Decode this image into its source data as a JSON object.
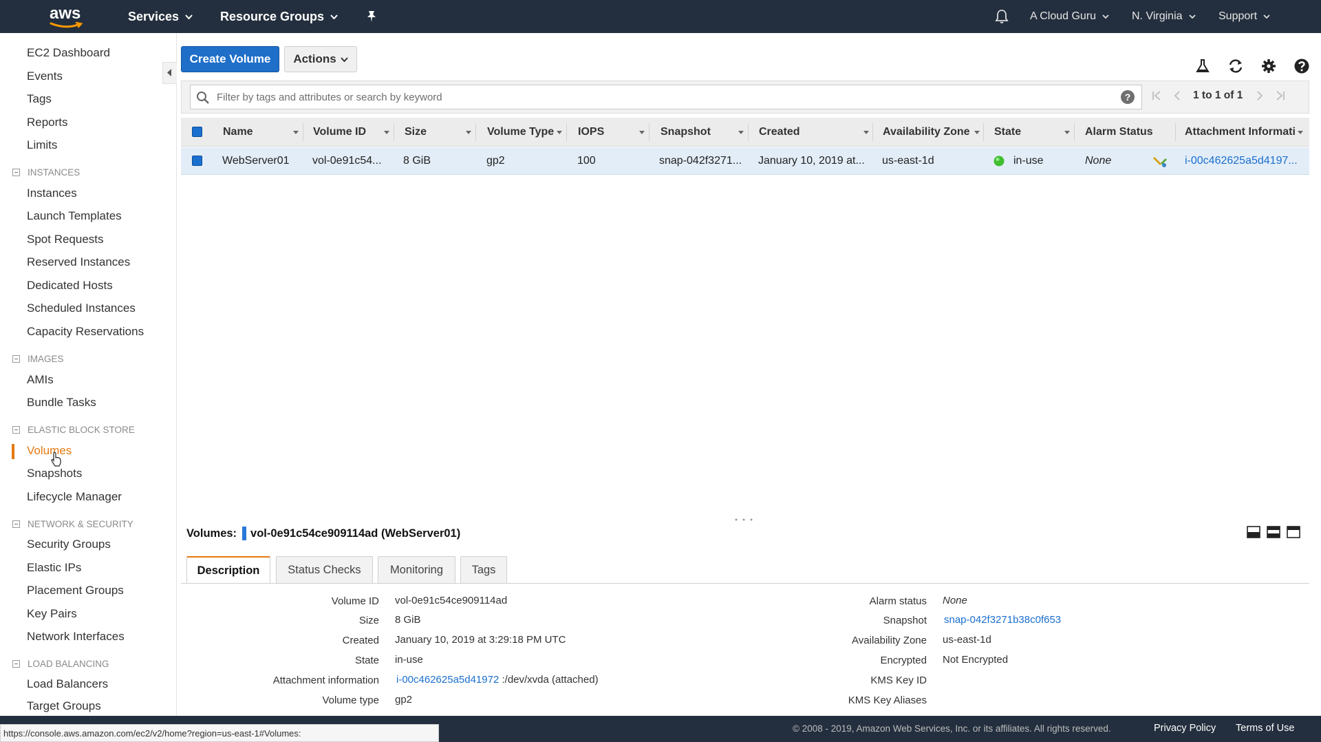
{
  "topnav": {
    "logo": "aws",
    "services": "Services",
    "resource_groups": "Resource Groups",
    "account": "A Cloud Guru",
    "region": "N. Virginia",
    "support": "Support"
  },
  "sidebar": {
    "top_items": [
      "EC2 Dashboard",
      "Events",
      "Tags",
      "Reports",
      "Limits"
    ],
    "sections": [
      {
        "title": "INSTANCES",
        "items": [
          "Instances",
          "Launch Templates",
          "Spot Requests",
          "Reserved Instances",
          "Dedicated Hosts",
          "Scheduled Instances",
          "Capacity Reservations"
        ]
      },
      {
        "title": "IMAGES",
        "items": [
          "AMIs",
          "Bundle Tasks"
        ]
      },
      {
        "title": "ELASTIC BLOCK STORE",
        "items": [
          "Volumes",
          "Snapshots",
          "Lifecycle Manager"
        ]
      },
      {
        "title": "NETWORK & SECURITY",
        "items": [
          "Security Groups",
          "Elastic IPs",
          "Placement Groups",
          "Key Pairs",
          "Network Interfaces"
        ]
      },
      {
        "title": "LOAD BALANCING",
        "items": [
          "Load Balancers",
          "Target Groups"
        ]
      }
    ],
    "active_item": "Volumes"
  },
  "toolbar": {
    "create_label": "Create Volume",
    "actions_label": "Actions"
  },
  "filter": {
    "placeholder": "Filter by tags and attributes or search by keyword",
    "help": "?",
    "pager_text": "1 to 1 of 1"
  },
  "table": {
    "columns": [
      "Name",
      "Volume ID",
      "Size",
      "Volume Type",
      "IOPS",
      "Snapshot",
      "Created",
      "Availability Zone",
      "State",
      "Alarm Status",
      "Attachment Informati"
    ],
    "rows": [
      {
        "name": "WebServer01",
        "volume_id": "vol-0e91c54...",
        "size": "8 GiB",
        "volume_type": "gp2",
        "iops": "100",
        "snapshot": "snap-042f3271...",
        "created": "January 10, 2019 at...",
        "availability_zone": "us-east-1d",
        "state": "in-use",
        "alarm_status": "None",
        "attachment": "i-00c462625a5d4197..."
      }
    ]
  },
  "details": {
    "label": "Volumes:",
    "selected": "vol-0e91c54ce909114ad (WebServer01)",
    "tabs": [
      "Description",
      "Status Checks",
      "Monitoring",
      "Tags"
    ],
    "left": [
      {
        "label": "Volume ID",
        "value": "vol-0e91c54ce909114ad"
      },
      {
        "label": "Size",
        "value": "8 GiB"
      },
      {
        "label": "Created",
        "value": "January 10, 2019 at 3:29:18 PM UTC"
      },
      {
        "label": "State",
        "value": "in-use"
      },
      {
        "label": "Attachment information",
        "link": "i-00c462625a5d41972",
        "value": ":/dev/xvda (attached)"
      },
      {
        "label": "Volume type",
        "value": "gp2"
      }
    ],
    "right": [
      {
        "label": "Alarm status",
        "value": "None"
      },
      {
        "label": "Snapshot",
        "link": "snap-042f3271b38c0f653"
      },
      {
        "label": "Availability Zone",
        "value": "us-east-1d"
      },
      {
        "label": "Encrypted",
        "value": "Not Encrypted"
      },
      {
        "label": "KMS Key ID",
        "value": ""
      },
      {
        "label": "KMS Key Aliases",
        "value": ""
      }
    ]
  },
  "footer": {
    "copyright": "© 2008 - 2019, Amazon Web Services, Inc. or its affiliates. All rights reserved.",
    "privacy": "Privacy Policy",
    "terms": "Terms of Use"
  },
  "status_url": "https://console.aws.amazon.com/ec2/v2/home?region=us-east-1#Volumes:",
  "colors": {
    "nav_bg": "#232f3e",
    "primary": "#1f6fc9",
    "active": "#e47911",
    "state_ok": "#3fbf2f",
    "link": "#1a6fcf"
  }
}
